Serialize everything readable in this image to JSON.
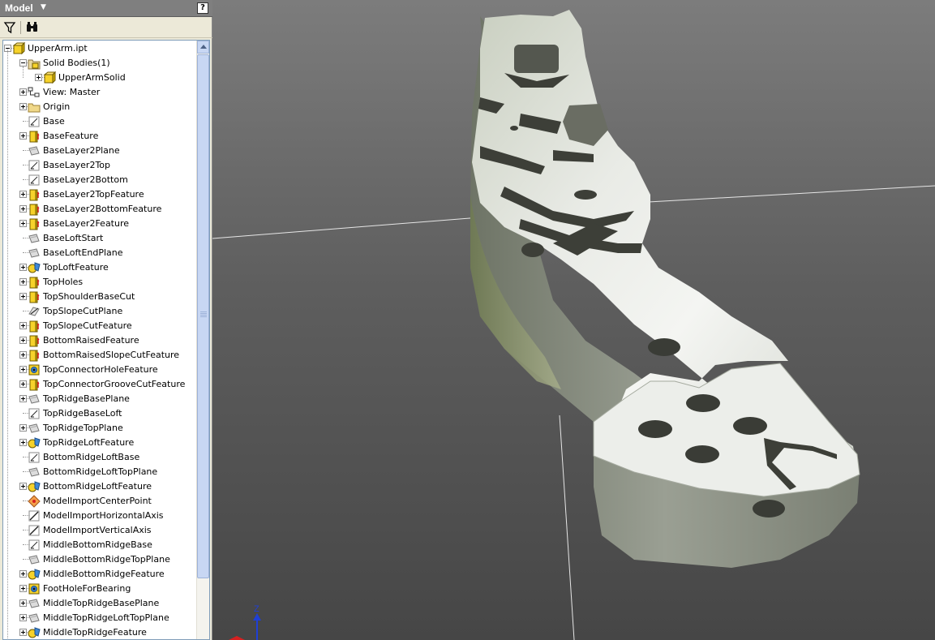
{
  "panel": {
    "title": "Model",
    "help_label": "?",
    "toolbar": {
      "filter_icon": "filter-icon",
      "find_icon": "binoculars-icon"
    }
  },
  "tree": {
    "items": [
      {
        "label": "UpperArm.ipt",
        "level": 0,
        "expander": "minus",
        "icon": "part-icon"
      },
      {
        "label": "Solid Bodies(1)",
        "level": 1,
        "expander": "minus",
        "icon": "solid-bodies-icon"
      },
      {
        "label": "UpperArmSolid",
        "level": 2,
        "expander": "plus",
        "icon": "solid-body-icon"
      },
      {
        "label": "View: Master",
        "level": 1,
        "expander": "plus",
        "icon": "view-rep-icon"
      },
      {
        "label": "Origin",
        "level": 1,
        "expander": "plus",
        "icon": "folder-icon"
      },
      {
        "label": "Base",
        "level": 1,
        "expander": "none",
        "icon": "sketch-icon"
      },
      {
        "label": "BaseFeature",
        "level": 1,
        "expander": "plus",
        "icon": "extrusion-icon"
      },
      {
        "label": "BaseLayer2Plane",
        "level": 1,
        "expander": "none",
        "icon": "work-plane-icon"
      },
      {
        "label": "BaseLayer2Top",
        "level": 1,
        "expander": "none",
        "icon": "sketch-icon"
      },
      {
        "label": "BaseLayer2Bottom",
        "level": 1,
        "expander": "none",
        "icon": "sketch-icon"
      },
      {
        "label": "BaseLayer2TopFeature",
        "level": 1,
        "expander": "plus",
        "icon": "extrusion-icon"
      },
      {
        "label": "BaseLayer2BottomFeature",
        "level": 1,
        "expander": "plus",
        "icon": "extrusion-icon"
      },
      {
        "label": "BaseLayer2Feature",
        "level": 1,
        "expander": "plus",
        "icon": "extrusion-icon"
      },
      {
        "label": "BaseLoftStart",
        "level": 1,
        "expander": "none",
        "icon": "work-plane-icon"
      },
      {
        "label": "BaseLoftEndPlane",
        "level": 1,
        "expander": "none",
        "icon": "work-plane-icon"
      },
      {
        "label": "TopLoftFeature",
        "level": 1,
        "expander": "plus",
        "icon": "loft-icon"
      },
      {
        "label": "TopHoles",
        "level": 1,
        "expander": "plus",
        "icon": "extrusion-icon"
      },
      {
        "label": "TopShoulderBaseCut",
        "level": 1,
        "expander": "plus",
        "icon": "extrusion-icon"
      },
      {
        "label": "TopSlopeCutPlane",
        "level": 1,
        "expander": "none",
        "icon": "work-plane-angled-icon"
      },
      {
        "label": "TopSlopeCutFeature",
        "level": 1,
        "expander": "plus",
        "icon": "extrusion-icon"
      },
      {
        "label": "BottomRaisedFeature",
        "level": 1,
        "expander": "plus",
        "icon": "extrusion-icon"
      },
      {
        "label": "BottomRaisedSlopeCutFeature",
        "level": 1,
        "expander": "plus",
        "icon": "extrusion-icon"
      },
      {
        "label": "TopConnectorHoleFeature",
        "level": 1,
        "expander": "plus",
        "icon": "hole-icon"
      },
      {
        "label": "TopConnectorGrooveCutFeature",
        "level": 1,
        "expander": "plus",
        "icon": "extrusion-icon"
      },
      {
        "label": "TopRidgeBasePlane",
        "level": 1,
        "expander": "plus",
        "icon": "work-plane-icon"
      },
      {
        "label": "TopRidgeBaseLoft",
        "level": 1,
        "expander": "none",
        "icon": "sketch-icon"
      },
      {
        "label": "TopRidgeTopPlane",
        "level": 1,
        "expander": "plus",
        "icon": "work-plane-icon"
      },
      {
        "label": "TopRidgeLoftFeature",
        "level": 1,
        "expander": "plus",
        "icon": "loft-icon"
      },
      {
        "label": "BottomRidgeLoftBase",
        "level": 1,
        "expander": "none",
        "icon": "sketch-icon"
      },
      {
        "label": "BottomRidgeLoftTopPlane",
        "level": 1,
        "expander": "none",
        "icon": "work-plane-icon"
      },
      {
        "label": "BottomRidgeLoftFeature",
        "level": 1,
        "expander": "plus",
        "icon": "loft-icon"
      },
      {
        "label": "ModelImportCenterPoint",
        "level": 1,
        "expander": "none",
        "icon": "work-point-icon"
      },
      {
        "label": "ModelImportHorizontalAxis",
        "level": 1,
        "expander": "none",
        "icon": "work-axis-icon"
      },
      {
        "label": "ModelImportVerticalAxis",
        "level": 1,
        "expander": "none",
        "icon": "work-axis-icon"
      },
      {
        "label": "MiddleBottomRidgeBase",
        "level": 1,
        "expander": "none",
        "icon": "sketch-icon"
      },
      {
        "label": "MiddleBottomRidgeTopPlane",
        "level": 1,
        "expander": "none",
        "icon": "work-plane-icon"
      },
      {
        "label": "MiddleBottomRidgeFeature",
        "level": 1,
        "expander": "plus",
        "icon": "loft-icon"
      },
      {
        "label": "FootHoleForBearing",
        "level": 1,
        "expander": "plus",
        "icon": "hole-icon"
      },
      {
        "label": "MiddleTopRidgeBasePlane",
        "level": 1,
        "expander": "plus",
        "icon": "work-plane-icon"
      },
      {
        "label": "MiddleTopRidgeLoftTopPlane",
        "level": 1,
        "expander": "plus",
        "icon": "work-plane-icon"
      },
      {
        "label": "MiddleTopRidgeFeature",
        "level": 1,
        "expander": "plus",
        "icon": "loft-icon"
      }
    ]
  },
  "viewport": {
    "axis_label": "Z",
    "colors": {
      "background_top": "#7c7c7c",
      "background_bottom": "#464646",
      "part_surface": "#d9ddd6",
      "part_side": "#8a8f83",
      "axis_z": "#1f3fd6",
      "axis_x": "#d62020"
    }
  }
}
